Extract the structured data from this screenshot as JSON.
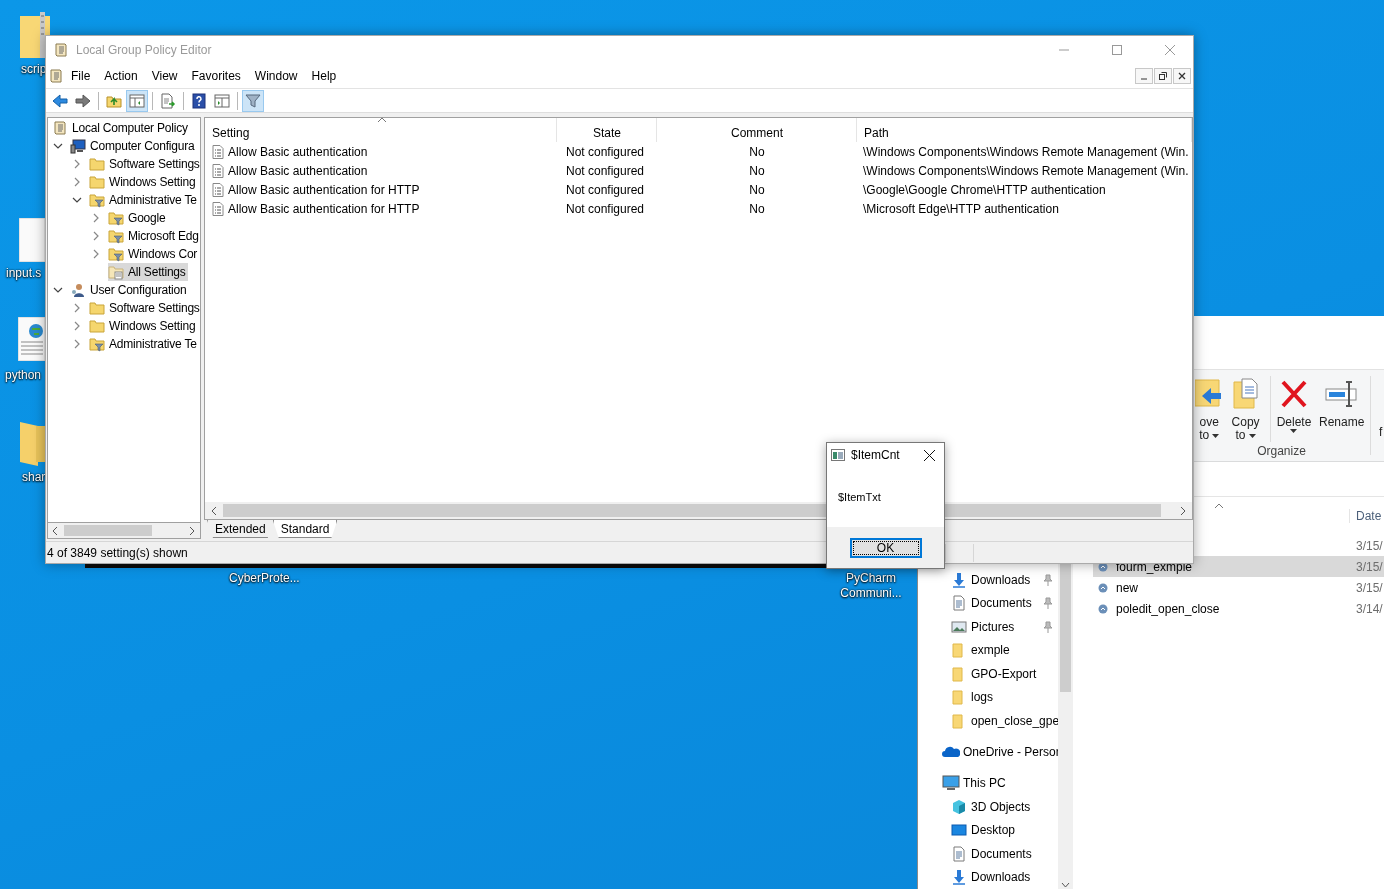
{
  "desktop": {
    "icons": [
      {
        "label": "scrip",
        "kind": "zip-folder"
      },
      {
        "label": "input.s",
        "kind": "document"
      },
      {
        "label": "python",
        "kind": "web-document"
      },
      {
        "label": "shar",
        "kind": "folder"
      }
    ],
    "labels": [
      {
        "label": "CyberProte..."
      },
      {
        "label": "PyCharm Communi..."
      }
    ]
  },
  "explorer": {
    "ribbon": {
      "buttons": [
        {
          "label": "ove",
          "sublabel": "to",
          "kind": "move",
          "dropdown": true
        },
        {
          "label": "Copy",
          "sublabel": "to",
          "kind": "copy",
          "dropdown": true
        },
        {
          "label": "Delete",
          "kind": "delete",
          "dropdown": true
        },
        {
          "label": "Rename",
          "kind": "rename",
          "dropdown": false
        }
      ],
      "group_label": "Organize",
      "next_group": "f"
    },
    "quick_access": [
      {
        "label": "Downloads",
        "kind": "download",
        "pinned": true
      },
      {
        "label": "Documents",
        "kind": "document",
        "pinned": true
      },
      {
        "label": "Pictures",
        "kind": "pictures",
        "pinned": true
      },
      {
        "label": "exmple",
        "kind": "folder",
        "pinned": false
      },
      {
        "label": "GPO-Export",
        "kind": "folder",
        "pinned": false
      },
      {
        "label": "logs",
        "kind": "folder",
        "pinned": false
      },
      {
        "label": "open_close_gpe",
        "kind": "folder",
        "pinned": false
      }
    ],
    "tree": [
      {
        "label": "OneDrive - Persor",
        "kind": "onedrive"
      },
      {
        "label": "This PC",
        "kind": "pc",
        "children": [
          {
            "label": "3D Objects",
            "kind": "cube"
          },
          {
            "label": "Desktop",
            "kind": "desktop"
          },
          {
            "label": "Documents",
            "kind": "document"
          },
          {
            "label": "Downloads",
            "kind": "download"
          }
        ]
      }
    ],
    "column_header": "Date",
    "files": [
      {
        "date": "3/15/",
        "selected": false
      },
      {
        "name": "fourm_exmple",
        "date": "3/15/",
        "selected": true
      },
      {
        "name": "new",
        "date": "3/15/",
        "selected": false
      },
      {
        "name": "poledit_open_close",
        "date": "3/14/",
        "selected": false
      }
    ]
  },
  "gpe": {
    "title": "Local Group Policy Editor",
    "menu": [
      "File",
      "Action",
      "View",
      "Favorites",
      "Window",
      "Help"
    ],
    "toolbar": [
      {
        "kind": "back",
        "pressed": false
      },
      {
        "kind": "forward",
        "pressed": false
      },
      {
        "kind": "separator"
      },
      {
        "kind": "up",
        "pressed": false
      },
      {
        "kind": "tree",
        "pressed": true
      },
      {
        "kind": "separator"
      },
      {
        "kind": "export",
        "pressed": false
      },
      {
        "kind": "separator"
      },
      {
        "kind": "help",
        "pressed": false
      },
      {
        "kind": "properties",
        "pressed": false
      },
      {
        "kind": "separator"
      },
      {
        "kind": "filter",
        "pressed": true
      }
    ],
    "tree": [
      {
        "label": "Local Computer Policy",
        "kind": "policy",
        "selected": false,
        "children": [
          {
            "label": "Computer Configura",
            "kind": "computer",
            "expanded": true,
            "selected": false,
            "children": [
              {
                "label": "Software Settings",
                "kind": "folder",
                "expanded": false,
                "selected": false
              },
              {
                "label": "Windows Setting",
                "kind": "folder",
                "expanded": false,
                "selected": false
              },
              {
                "label": "Administrative Te",
                "kind": "admin-folder",
                "expanded": true,
                "selected": false,
                "children": [
                  {
                    "label": "Google",
                    "kind": "admin-folder",
                    "expanded": false,
                    "selected": false
                  },
                  {
                    "label": "Microsoft Edg",
                    "kind": "admin-folder",
                    "expanded": false,
                    "selected": false
                  },
                  {
                    "label": "Windows Cor",
                    "kind": "admin-folder",
                    "expanded": false,
                    "selected": false
                  },
                  {
                    "label": "All Settings",
                    "kind": "all-settings",
                    "selected": true
                  }
                ]
              }
            ]
          },
          {
            "label": "User Configuration",
            "kind": "user",
            "expanded": true,
            "selected": false,
            "children": [
              {
                "label": "Software Settings",
                "kind": "folder",
                "expanded": false,
                "selected": false
              },
              {
                "label": "Windows Setting",
                "kind": "folder",
                "expanded": false,
                "selected": false
              },
              {
                "label": "Administrative Te",
                "kind": "admin-folder",
                "expanded": false,
                "selected": false
              }
            ]
          }
        ]
      }
    ],
    "table": {
      "columns": [
        "Setting",
        "State",
        "Comment",
        "Path"
      ],
      "rows": [
        {
          "setting": "Allow Basic authentication",
          "state": "Not configured",
          "comment": "No",
          "path": "\\Windows Components\\Windows Remote Management (Win."
        },
        {
          "setting": "Allow Basic authentication",
          "state": "Not configured",
          "comment": "No",
          "path": "\\Windows Components\\Windows Remote Management (Win."
        },
        {
          "setting": "Allow Basic authentication for HTTP",
          "state": "Not configured",
          "comment": "No",
          "path": "\\Google\\Google Chrome\\HTTP authentication"
        },
        {
          "setting": "Allow Basic authentication for HTTP",
          "state": "Not configured",
          "comment": "No",
          "path": "\\Microsoft Edge\\HTTP authentication"
        }
      ]
    },
    "tabs": [
      {
        "label": "Extended",
        "selected": false
      },
      {
        "label": "Standard",
        "selected": true
      }
    ],
    "status_bar": "4 of 3849 setting(s) shown"
  },
  "dialog": {
    "title": "$ItemCnt",
    "message": "$ItemTxt",
    "button": "OK"
  }
}
